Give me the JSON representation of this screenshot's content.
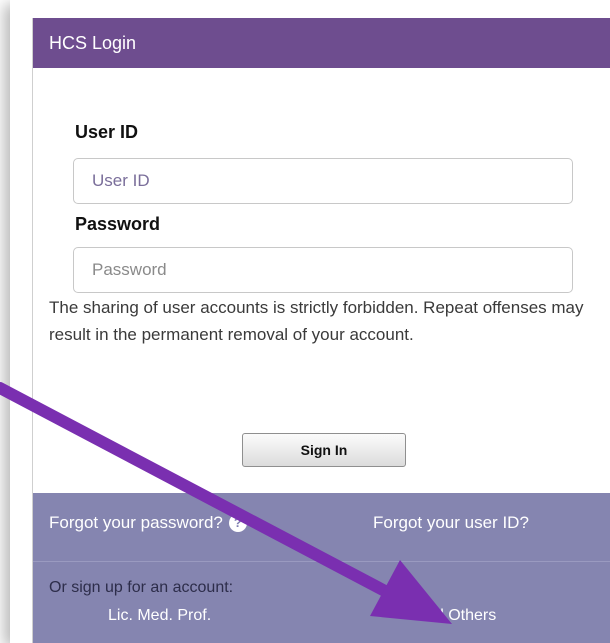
{
  "header": {
    "title": "HCS Login"
  },
  "form": {
    "user_id_label": "User ID",
    "user_id_placeholder": "User ID",
    "password_label": "Password",
    "password_placeholder": "Password",
    "notice": "The sharing of user accounts is strictly forbidden. Repeat offenses may result in the permanent removal of your account.",
    "sign_in_label": "Sign In"
  },
  "footer": {
    "forgot_password": "Forgot your password?",
    "help_icon_glyph": "?",
    "forgot_user_id": "Forgot your user ID?",
    "signup_prompt": "Or sign up for an account:",
    "lic_med_prof": "Lic. Med. Prof.",
    "all_others": "All Others"
  },
  "colors": {
    "header_bg": "#6e4d8f",
    "footer_bg": "#8585b0",
    "arrow": "#7a2fb0"
  }
}
